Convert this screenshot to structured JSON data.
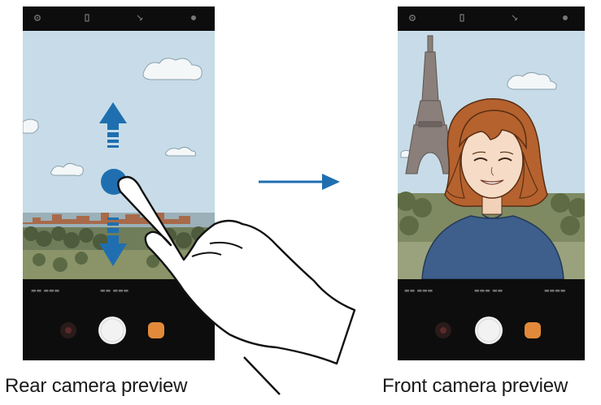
{
  "captions": {
    "rear": "Rear camera preview",
    "front": "Front camera preview"
  },
  "colors": {
    "arrow_blue": "#1f6fb0",
    "sky": "#c5dbe7",
    "phone_body": "#0d0d0d",
    "shirt": "#3e5f8c",
    "hair": "#b5622e"
  },
  "icons": {
    "settings": "gear-icon",
    "flash": "flash-icon",
    "timer": "timer-icon",
    "effects": "effects-icon",
    "shutter": "shutter-button",
    "gallery": "gallery-thumbnail",
    "switch": "switch-camera-icon"
  },
  "gesture": {
    "direction": "swipe up or down",
    "arrows": [
      "up-arrow",
      "down-arrow"
    ],
    "transition_arrow": "right"
  }
}
